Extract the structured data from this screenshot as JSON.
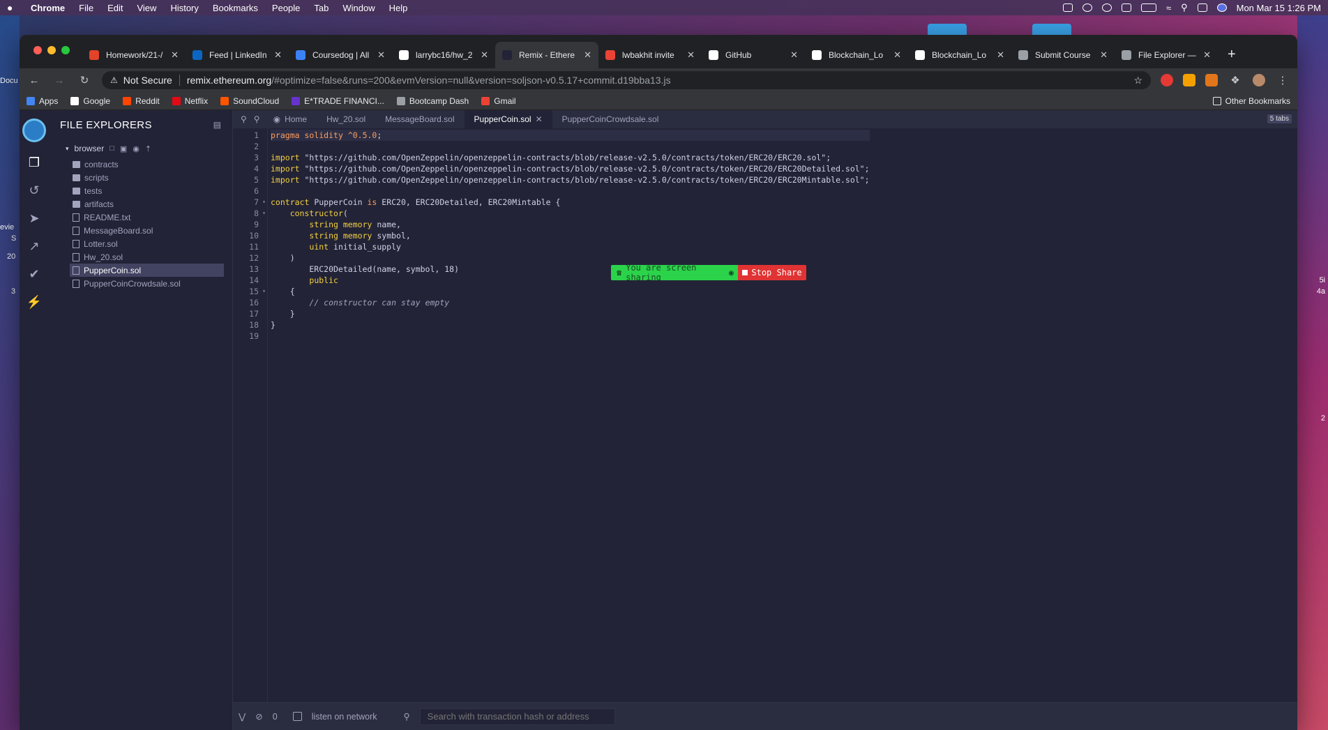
{
  "menubar": {
    "app": "Chrome",
    "items": [
      "File",
      "Edit",
      "View",
      "History",
      "Bookmarks",
      "People",
      "Tab",
      "Window",
      "Help"
    ],
    "clock": "Mon Mar 15  1:26 PM"
  },
  "desktop": {
    "left_labels": [
      "Docu",
      "evie",
      "S",
      "20",
      "3"
    ],
    "right_labels": [
      "5i",
      "4a",
      "2"
    ]
  },
  "tabs": [
    {
      "title": "Homework/21-/",
      "icon_color": "#e24329",
      "icon": "gitlab-icon"
    },
    {
      "title": "Feed | LinkedIn",
      "icon_color": "#0a66c2",
      "icon": "linkedin-icon"
    },
    {
      "title": "Coursedog | All",
      "icon_color": "#3b82f6",
      "icon": "coursedog-icon"
    },
    {
      "title": "larrybc16/hw_2",
      "icon_color": "#ffffff",
      "icon": "github-icon"
    },
    {
      "title": "Remix - Ethere",
      "icon_color": "#222336",
      "icon": "remix-icon",
      "active": true
    },
    {
      "title": "lwbakhit invite",
      "icon_color": "#ea4335",
      "icon": "gmail-icon"
    },
    {
      "title": "GitHub",
      "icon_color": "#ffffff",
      "icon": "github-icon"
    },
    {
      "title": "Blockchain_Lo",
      "icon_color": "#ffffff",
      "icon": "github-icon"
    },
    {
      "title": "Blockchain_Lo",
      "icon_color": "#ffffff",
      "icon": "github-icon"
    },
    {
      "title": "Submit Course",
      "icon_color": "#9aa0a6",
      "icon": "globe-icon"
    },
    {
      "title": "File Explorer —",
      "icon_color": "#9aa0a6",
      "icon": "doc-icon"
    }
  ],
  "omnibox": {
    "security_label": "Not Secure",
    "host": "remix.ethereum.org",
    "path": "/#optimize=false&runs=200&evmVersion=null&version=soljson-v0.5.17+commit.d19bba13.js"
  },
  "bookmarks": [
    {
      "label": "Apps",
      "color": "#4285f4"
    },
    {
      "label": "Google",
      "color": "#ffffff"
    },
    {
      "label": "Reddit",
      "color": "#ff4500"
    },
    {
      "label": "Netflix",
      "color": "#e50914"
    },
    {
      "label": "SoundCloud",
      "color": "#ff5500"
    },
    {
      "label": "E*TRADE FINANCI...",
      "color": "#6633cc"
    },
    {
      "label": "Bootcamp Dash",
      "color": "#9aa0a6"
    },
    {
      "label": "Gmail",
      "color": "#ea4335"
    }
  ],
  "other_bookmarks": "Other Bookmarks",
  "sidebar": {
    "title": "FILE EXPLORERS",
    "root": "browser",
    "items": [
      {
        "name": "contracts",
        "type": "folder"
      },
      {
        "name": "scripts",
        "type": "folder"
      },
      {
        "name": "tests",
        "type": "folder"
      },
      {
        "name": "artifacts",
        "type": "folder"
      },
      {
        "name": "README.txt",
        "type": "file"
      },
      {
        "name": "MessageBoard.sol",
        "type": "file"
      },
      {
        "name": "Lotter.sol",
        "type": "file"
      },
      {
        "name": "Hw_20.sol",
        "type": "file"
      },
      {
        "name": "PupperCoin.sol",
        "type": "file",
        "active": true
      },
      {
        "name": "PupperCoinCrowdsale.sol",
        "type": "file"
      }
    ]
  },
  "editor_tabs": [
    {
      "label": "Home"
    },
    {
      "label": "Hw_20.sol"
    },
    {
      "label": "MessageBoard.sol"
    },
    {
      "label": "PupperCoin.sol",
      "active": true
    },
    {
      "label": "PupperCoinCrowdsale.sol"
    }
  ],
  "tab_count": "5 tabs",
  "code_lines": [
    "<span class=\"kw\">pragma</span> <span class=\"kw\">solidity</span> <span class=\"kw\">^0.5.0</span>;",
    "",
    "<span class=\"kw2\">import</span> \"https://github.com/OpenZeppelin/openzeppelin-contracts/blob/release-v2.5.0/contracts/token/ERC20/ERC20.sol\";",
    "<span class=\"kw2\">import</span> \"https://github.com/OpenZeppelin/openzeppelin-contracts/blob/release-v2.5.0/contracts/token/ERC20/ERC20Detailed.sol\";",
    "<span class=\"kw2\">import</span> \"https://github.com/OpenZeppelin/openzeppelin-contracts/blob/release-v2.5.0/contracts/token/ERC20/ERC20Mintable.sol\";",
    "",
    "<span class=\"kw2\">contract</span> PupperCoin <span class=\"kw\">is</span> ERC20, ERC20Detailed, ERC20Mintable {",
    "    <span class=\"kw2\">constructor</span>(",
    "        <span class=\"typ\">string</span> <span class=\"kw2\">memory</span> name,",
    "        <span class=\"typ\">string</span> <span class=\"kw2\">memory</span> symbol,",
    "        <span class=\"typ\">uint</span> initial_supply",
    "    )",
    "        ERC20Detailed(name, symbol, 18)",
    "        <span class=\"kw2\">public</span>",
    "    {",
    "        <span class=\"cm\">// constructor can stay empty</span>",
    "    }",
    "}",
    ""
  ],
  "folds": [
    7,
    8,
    15
  ],
  "screen_share": {
    "message": "You are screen sharing",
    "stop": "Stop Share"
  },
  "terminal": {
    "count": "0",
    "listen_label": "listen on network",
    "search_placeholder": "Search with transaction hash or address"
  }
}
